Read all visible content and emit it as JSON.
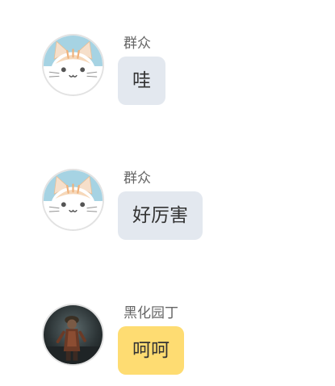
{
  "messages": [
    {
      "sender": "群众",
      "text": "哇",
      "avatar_icon": "cat-avatar-icon",
      "bubble_color": "#e3e8ef"
    },
    {
      "sender": "群众",
      "text": "好厉害",
      "avatar_icon": "cat-avatar-icon",
      "bubble_color": "#e3e8ef"
    },
    {
      "sender": "黑化园丁",
      "text": "呵呵",
      "avatar_icon": "character-portrait-icon",
      "bubble_color": "#fedc72"
    }
  ]
}
